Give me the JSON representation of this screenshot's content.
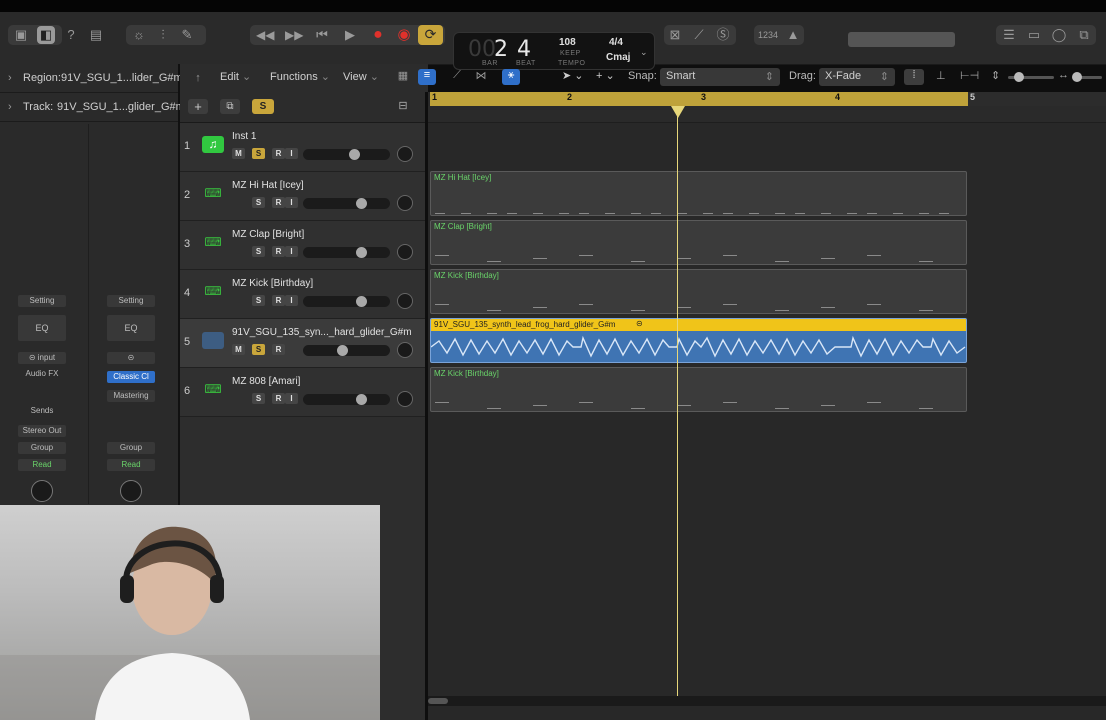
{
  "transport": {
    "bar_dim": "00",
    "bar": "2",
    "beat": "4",
    "bar_label": "BAR",
    "beat_label": "BEAT",
    "tempo": "108",
    "tempo_mode": "KEEP",
    "tempo_label": "TEMPO",
    "signature": "4/4",
    "key": "Cmaj",
    "count_in": "1234"
  },
  "inspector": {
    "region_label": "Region:",
    "region_value": "91V_SGU_1...lider_G#m",
    "track_label": "Track:",
    "track_value": "91V_SGU_1...glider_G#m",
    "strip1": {
      "setting": "Setting",
      "eq": "EQ",
      "input": "input",
      "audio_fx": "Audio FX",
      "sends": "Sends",
      "output": "Stereo Out",
      "group": "Group",
      "automation": "Read"
    },
    "strip2": {
      "setting": "Setting",
      "eq": "EQ",
      "plugin": "Classic Cl",
      "mastering": "Mastering",
      "group": "Group",
      "automation": "Read"
    }
  },
  "editbar": {
    "edit": "Edit",
    "functions": "Functions",
    "view": "View",
    "snap_label": "Snap:",
    "snap_value": "Smart",
    "drag_label": "Drag:",
    "drag_value": "X-Fade"
  },
  "trackheader": {
    "s_button": "S"
  },
  "tracks": [
    {
      "num": "1",
      "name": "Inst 1",
      "m": "M",
      "s": "S",
      "r": "R",
      "i": "I",
      "solo": true,
      "vol": 0.6,
      "icon_color": "#31c840"
    },
    {
      "num": "2",
      "name": "MZ Hi Hat [Icey]",
      "s": "S",
      "r": "R",
      "i": "I",
      "solo": false,
      "vol": 0.7,
      "icon_color": "#2a8f2a"
    },
    {
      "num": "3",
      "name": "MZ Clap [Bright]",
      "s": "S",
      "r": "R",
      "i": "I",
      "solo": false,
      "vol": 0.7,
      "icon_color": "#2a8f2a"
    },
    {
      "num": "4",
      "name": "MZ Kick [Birthday]",
      "s": "S",
      "r": "R",
      "i": "I",
      "solo": false,
      "vol": 0.7,
      "icon_color": "#2a8f2a"
    },
    {
      "num": "5",
      "name": "91V_SGU_135_syn..._hard_glider_G#m",
      "m": "M",
      "s": "S",
      "r": "R",
      "solo": true,
      "vol": 0.45,
      "icon_color": "#3f74b3"
    },
    {
      "num": "6",
      "name": "MZ 808 [Amari]",
      "s": "S",
      "r": "R",
      "i": "I",
      "solo": false,
      "vol": 0.7,
      "icon_color": "#2a8f2a"
    }
  ],
  "ruler": {
    "bars": [
      "1",
      "2",
      "3",
      "4",
      "5"
    ]
  },
  "regions": [
    {
      "name": "MZ Hi Hat [Icey]"
    },
    {
      "name": "MZ Clap [Bright]"
    },
    {
      "name": "MZ Kick [Birthday]"
    },
    {
      "name": "91V_SGU_135_synth_lead_frog_hard_glider_G#m"
    },
    {
      "name": "MZ Kick [Birthday]"
    }
  ],
  "colors": {
    "accent_yellow": "#f0c419",
    "region_green_text": "#6ad46a",
    "audio_blue": "#3f74b3",
    "record_red": "#e0312b"
  }
}
